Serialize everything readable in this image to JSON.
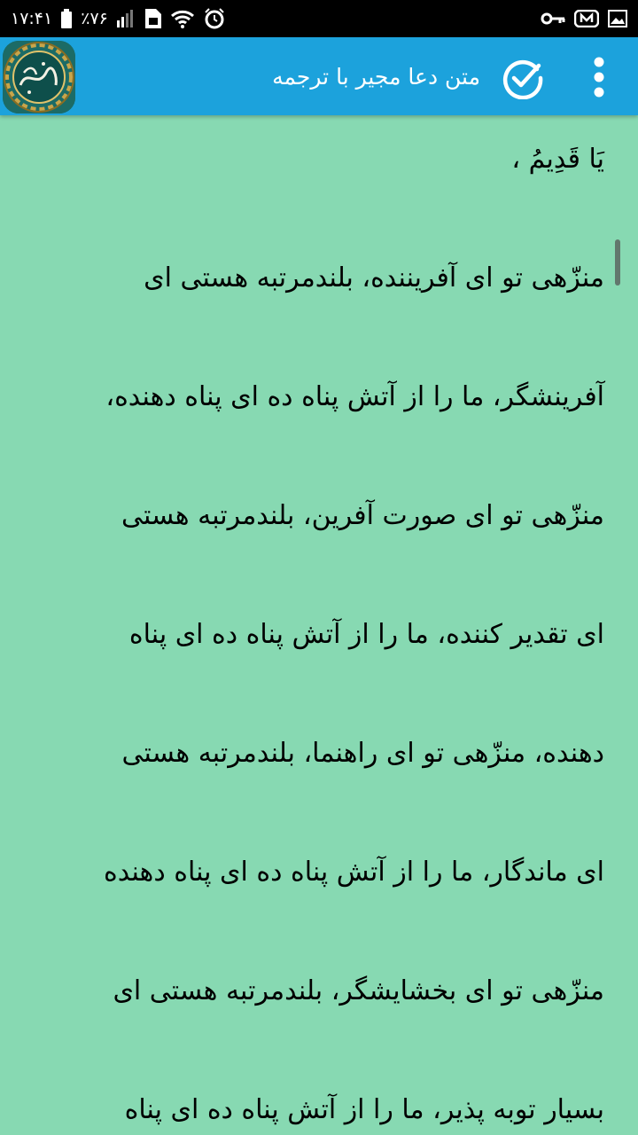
{
  "status_bar": {
    "time": "۱۷:۴۱",
    "battery_percent": "٪۷۶",
    "left_icons": [
      "battery-icon",
      "signal-icon",
      "sim-icon",
      "wifi-icon",
      "alarm-icon"
    ],
    "right_icons": [
      "key-icon",
      "voicemail-icon",
      "image-icon"
    ]
  },
  "app_bar": {
    "title": "متن دعا مجیر با ترجمه",
    "logo_text": "دعای مجیر",
    "check_icon": "check-circle-icon",
    "menu_icon": "more-vert-icon",
    "color": "#1ca2dc"
  },
  "content": {
    "background": "#87d9b2",
    "lines": [
      "يَا قَدِيمُ ،",
      "منزّهی تو ای آفریننده، بلندمرتبه هستی ای",
      "آفرینشگر، ما را از آتش پناه ده ای پناه دهنده،",
      "منزّهی تو ای صورت آفرین، بلندمرتبه هستی",
      "ای تقدیر کننده، ما را از آتش پناه ده ای پناه",
      "دهنده، منزّهی تو ای راهنما، بلندمرتبه هستی",
      "ای ماندگار، ما را از آتش پناه ده ای پناه دهنده",
      "منزّهی تو ای بخشایشگر، بلندمرتبه هستی ای",
      "بسیار توبه پذیر، ما را از آتش پناه ده ای پناه"
    ]
  }
}
